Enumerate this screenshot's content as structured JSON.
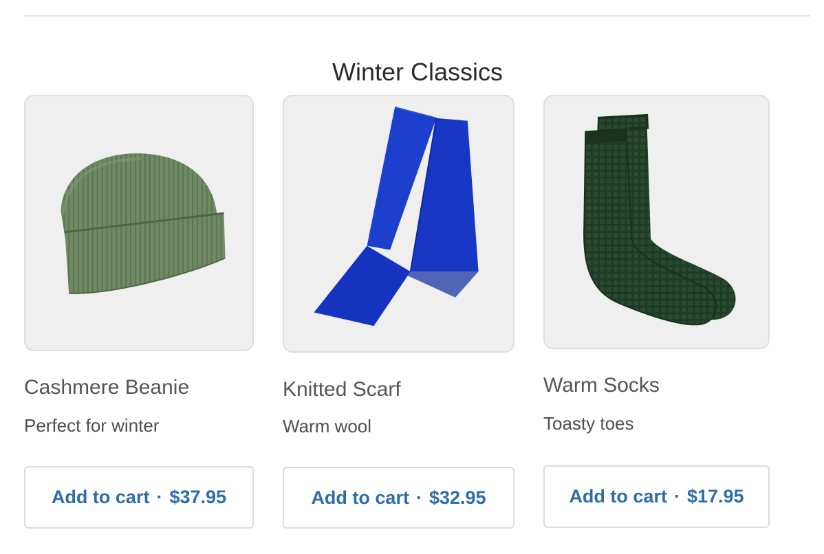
{
  "section": {
    "title": "Winter Classics"
  },
  "products": [
    {
      "name": "Cashmere Beanie",
      "description": "Perfect for winter",
      "cta": "Add to cart",
      "separator": "·",
      "price": "$37.95",
      "image_icon": "beanie-image",
      "color": "#6f8a65"
    },
    {
      "name": "Knitted Scarf",
      "description": "Warm wool",
      "cta": "Add to cart",
      "separator": "·",
      "price": "$32.95",
      "image_icon": "scarf-image",
      "color": "#1737c4"
    },
    {
      "name": "Warm Socks",
      "description": "Toasty toes",
      "cta": "Add to cart",
      "separator": "·",
      "price": "$17.95",
      "image_icon": "socks-image",
      "color": "#1f3a24"
    }
  ],
  "colors": {
    "link_blue": "#2f6da6",
    "card_background": "#efefef",
    "border": "#dcdcdc"
  }
}
